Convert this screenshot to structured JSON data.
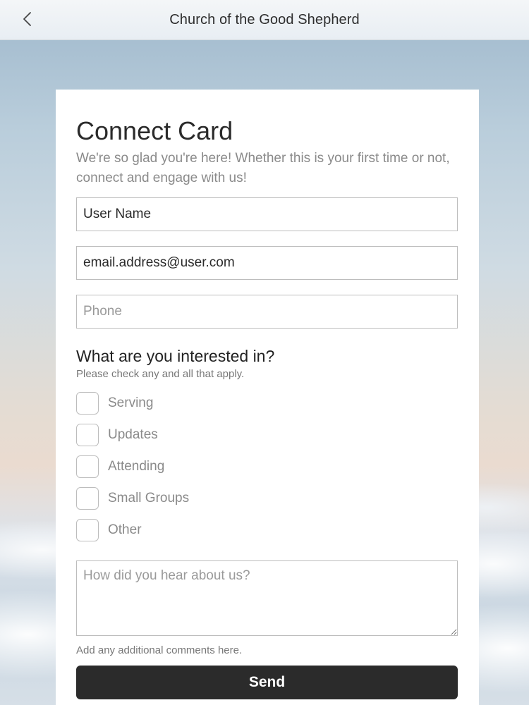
{
  "header": {
    "title": "Church of the Good Shepherd",
    "back_icon": "chevron-left-icon"
  },
  "form": {
    "title": "Connect Card",
    "intro": "We're so glad you're here! Whether this is your first time or not, connect and engage with us!",
    "name_value": "User Name",
    "email_value": "email.address@user.com",
    "phone_placeholder": "Phone",
    "interests_title": "What are you interested in?",
    "interests_hint": "Please check any and all that apply.",
    "interests": [
      {
        "label": "Serving",
        "checked": false
      },
      {
        "label": "Updates",
        "checked": false
      },
      {
        "label": "Attending",
        "checked": false
      },
      {
        "label": "Small Groups",
        "checked": false
      },
      {
        "label": "Other",
        "checked": false
      }
    ],
    "comments_placeholder": "How did you hear about us?",
    "comments_hint": "Add any additional comments here.",
    "send_label": "Send"
  },
  "colors": {
    "button_bg": "#2b2b2b",
    "field_border": "#bdbdbd",
    "muted_text": "#8a8a8a"
  }
}
